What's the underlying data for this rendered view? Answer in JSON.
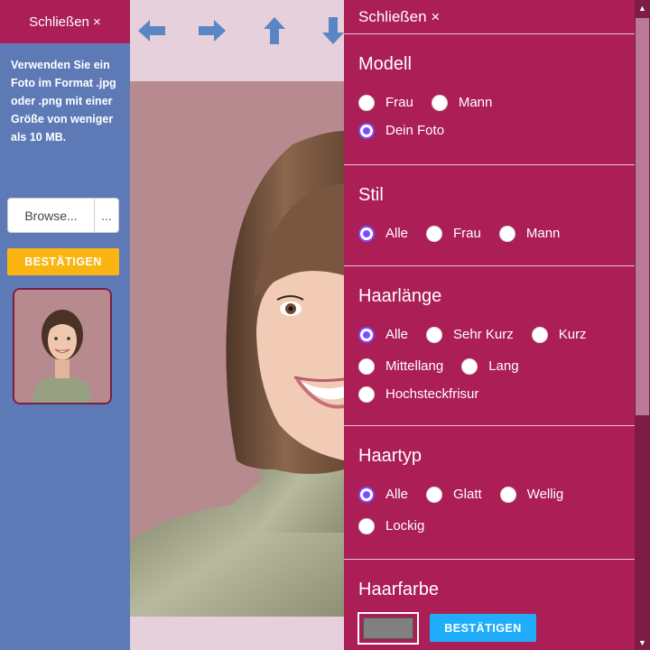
{
  "left_panel": {
    "close_label": "Schließen ×",
    "upload_hint": "Verwenden Sie ein Foto im Format .jpg oder .png mit einer Größe von weniger als 10 MB.",
    "browse_label": "Browse...",
    "browse_more": "...",
    "confirm_label": "BESTÄTIGEN"
  },
  "toolbar": {
    "icons": [
      "arrow-left-icon",
      "arrow-right-icon",
      "arrow-up-icon",
      "arrow-down-icon"
    ],
    "arrow_color": "#5b86c4"
  },
  "right_panel": {
    "close_label": "Schließen ×",
    "sections": {
      "modell": {
        "title": "Modell",
        "options": [
          "Frau",
          "Mann",
          "Dein Foto"
        ],
        "selected": "Dein Foto"
      },
      "stil": {
        "title": "Stil",
        "options": [
          "Alle",
          "Frau",
          "Mann"
        ],
        "selected": "Alle"
      },
      "haarlaenge": {
        "title": "Haarlänge",
        "options": [
          "Alle",
          "Sehr Kurz",
          "Kurz",
          "Mittellang",
          "Lang",
          "Hochsteckfrisur"
        ],
        "selected": "Alle"
      },
      "haartyp": {
        "title": "Haartyp",
        "options": [
          "Alle",
          "Glatt",
          "Wellig",
          "Lockig"
        ],
        "selected": "Alle"
      },
      "haarfarbe": {
        "title": "Haarfarbe",
        "swatch_color": "#808080",
        "confirm_label": "BESTÄTIGEN"
      }
    }
  },
  "colors": {
    "brand": "#ab1e56",
    "sidebar": "#5d7ab7",
    "accent_yellow": "#fbb512",
    "accent_blue": "#20aefb",
    "radio_selected": "#7c4dff"
  }
}
